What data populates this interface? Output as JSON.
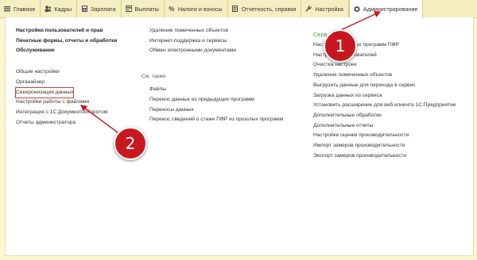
{
  "tabs": [
    {
      "label": "Главное",
      "icon": "menu-icon"
    },
    {
      "label": "Кадры",
      "icon": "people-icon"
    },
    {
      "label": "Зарплата",
      "icon": "calculator-icon"
    },
    {
      "label": "Выплаты",
      "icon": "payments-icon"
    },
    {
      "label": "Налоги и взносы",
      "icon": "percent-icon"
    },
    {
      "label": "Отчетность, справки",
      "icon": "reports-icon"
    },
    {
      "label": "Настройка",
      "icon": "wrench-icon"
    },
    {
      "label": "Администрирование",
      "icon": "gear-icon"
    }
  ],
  "column1": {
    "bold_links": [
      "Настройки пользователей и прав",
      "Печатные формы, отчеты и обработки",
      "Обслуживание"
    ],
    "links": [
      "Общие настройки",
      "Органайзер",
      "Синхронизация данных",
      "Настройки работы с файлами",
      "Интеграция с 1С:Документооборотом",
      "Отчеты администратора"
    ]
  },
  "column2": {
    "links_top": [
      "Удаление помеченных объектов",
      "Интернет-поддержка и сервисы",
      "Обмен электронными документами"
    ],
    "see_also": "См. также",
    "links_bottom": [
      "Файлы",
      "Перенос данных из предыдущих программ",
      "Переносы данных",
      "Перенос сведений о стаже ПФР из прошлых программ"
    ]
  },
  "column3": {
    "heading": "Серв",
    "links": [
      "Настр проверочных программ ПФР",
      "Настройки пользователей",
      "Очистка настроек",
      "Удаление помеченных объектов",
      "Выгрузить данные для перехода в сервис",
      "Загрузка данных из сервиса",
      "Установить расширение для веб-клиента 1С:Предприятие",
      "Дополнительные обработки",
      "Дополнительные отчеты",
      "Настройки оценки производительности",
      "Импорт замеров производительности",
      "Экспорт замеров производительности"
    ]
  },
  "callouts": {
    "one": "1",
    "two": "2"
  },
  "colors": {
    "badge": "#c8181f",
    "heading": "#3fa23a",
    "tabbar": "#f5eec0"
  }
}
